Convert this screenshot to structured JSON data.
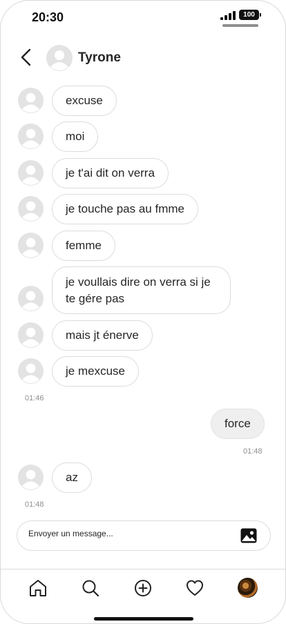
{
  "status_bar": {
    "time": "20:30",
    "battery": "100"
  },
  "header": {
    "contact_name": "Tyrone",
    "back_icon": "chevron-left-icon"
  },
  "messages": [
    {
      "text": "excuse"
    },
    {
      "text": "moi"
    },
    {
      "text": "je t'ai dit on verra"
    },
    {
      "text": "je touche pas au fmme"
    },
    {
      "text": "femme"
    },
    {
      "text": "je voullais dire on verra si je te gére pas"
    },
    {
      "text": "mais jt énerve"
    },
    {
      "text": "je mexcuse"
    },
    {
      "text": "force"
    },
    {
      "text": "az"
    }
  ],
  "timestamps": [
    "01:46",
    "01:48",
    "01:48"
  ],
  "composer": {
    "placeholder": "Envoyer un message...",
    "photo_icon": "image-icon"
  },
  "nav": {
    "items": [
      "home-icon",
      "search-icon",
      "plus-circle-icon",
      "heart-icon",
      "profile-avatar"
    ]
  }
}
